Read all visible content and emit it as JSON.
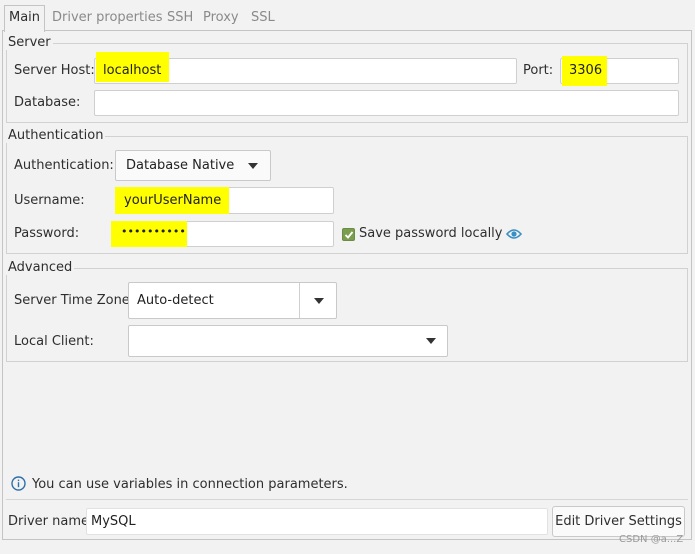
{
  "tabs": [
    "Main",
    "Driver properties",
    "SSH",
    "Proxy",
    "SSL"
  ],
  "server": {
    "group_title": "Server",
    "host_label": "Server Host:",
    "host_value": "localhost",
    "port_label": "Port:",
    "port_value": "3306",
    "database_label": "Database:",
    "database_value": ""
  },
  "authentication": {
    "group_title": "Authentication",
    "auth_label": "Authentication:",
    "auth_value": "Database Native",
    "username_label": "Username:",
    "username_value": "yourUserName",
    "password_label": "Password:",
    "password_value": "••••••••••",
    "save_password_label": "Save password locally",
    "save_password_checked": true
  },
  "advanced": {
    "group_title": "Advanced",
    "timezone_label": "Server Time Zone:",
    "timezone_value": "Auto-detect",
    "local_client_label": "Local Client:",
    "local_client_value": ""
  },
  "info_text": "You can use variables in connection parameters.",
  "driver": {
    "name_label": "Driver name:",
    "name_value": "MySQL",
    "edit_button": "Edit Driver Settings"
  },
  "watermark": "CSDN @a...Z",
  "colors": {
    "highlight": "#ffff00",
    "checkbox": "#7a9e4e",
    "eye_icon": "#3a8fc4",
    "info_icon": "#2f6fa8"
  }
}
